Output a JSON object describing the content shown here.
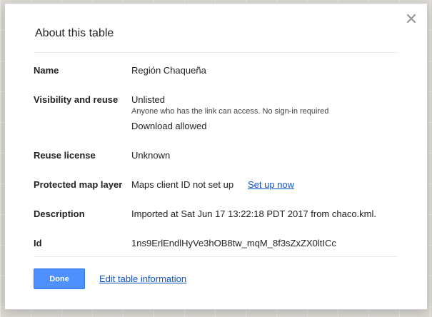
{
  "dialog": {
    "title": "About this table",
    "close_icon": "close-icon",
    "rows": {
      "name": {
        "label": "Name",
        "value": "Región Chaqueña"
      },
      "visibility": {
        "label": "Visibility and reuse",
        "value": "Unlisted",
        "note": "Anyone who has the link can access. No sign-in required",
        "download": "Download allowed"
      },
      "license": {
        "label": "Reuse license",
        "value": "Unknown"
      },
      "protected": {
        "label": "Protected map layer",
        "value": "Maps client ID not set up",
        "link": "Set up now"
      },
      "description": {
        "label": "Description",
        "value": "Imported at Sat Jun 17 13:22:18 PDT 2017 from chaco.kml."
      },
      "id": {
        "label": "Id",
        "value": "1ns9ErlEndlHyVe3hOB8tw_mqM_8f3sZxZX0ltICc"
      }
    },
    "buttons": {
      "done": "Done",
      "edit": "Edit table information"
    }
  },
  "colors": {
    "primary_button": "#4d90fe",
    "link": "#1155cc"
  }
}
